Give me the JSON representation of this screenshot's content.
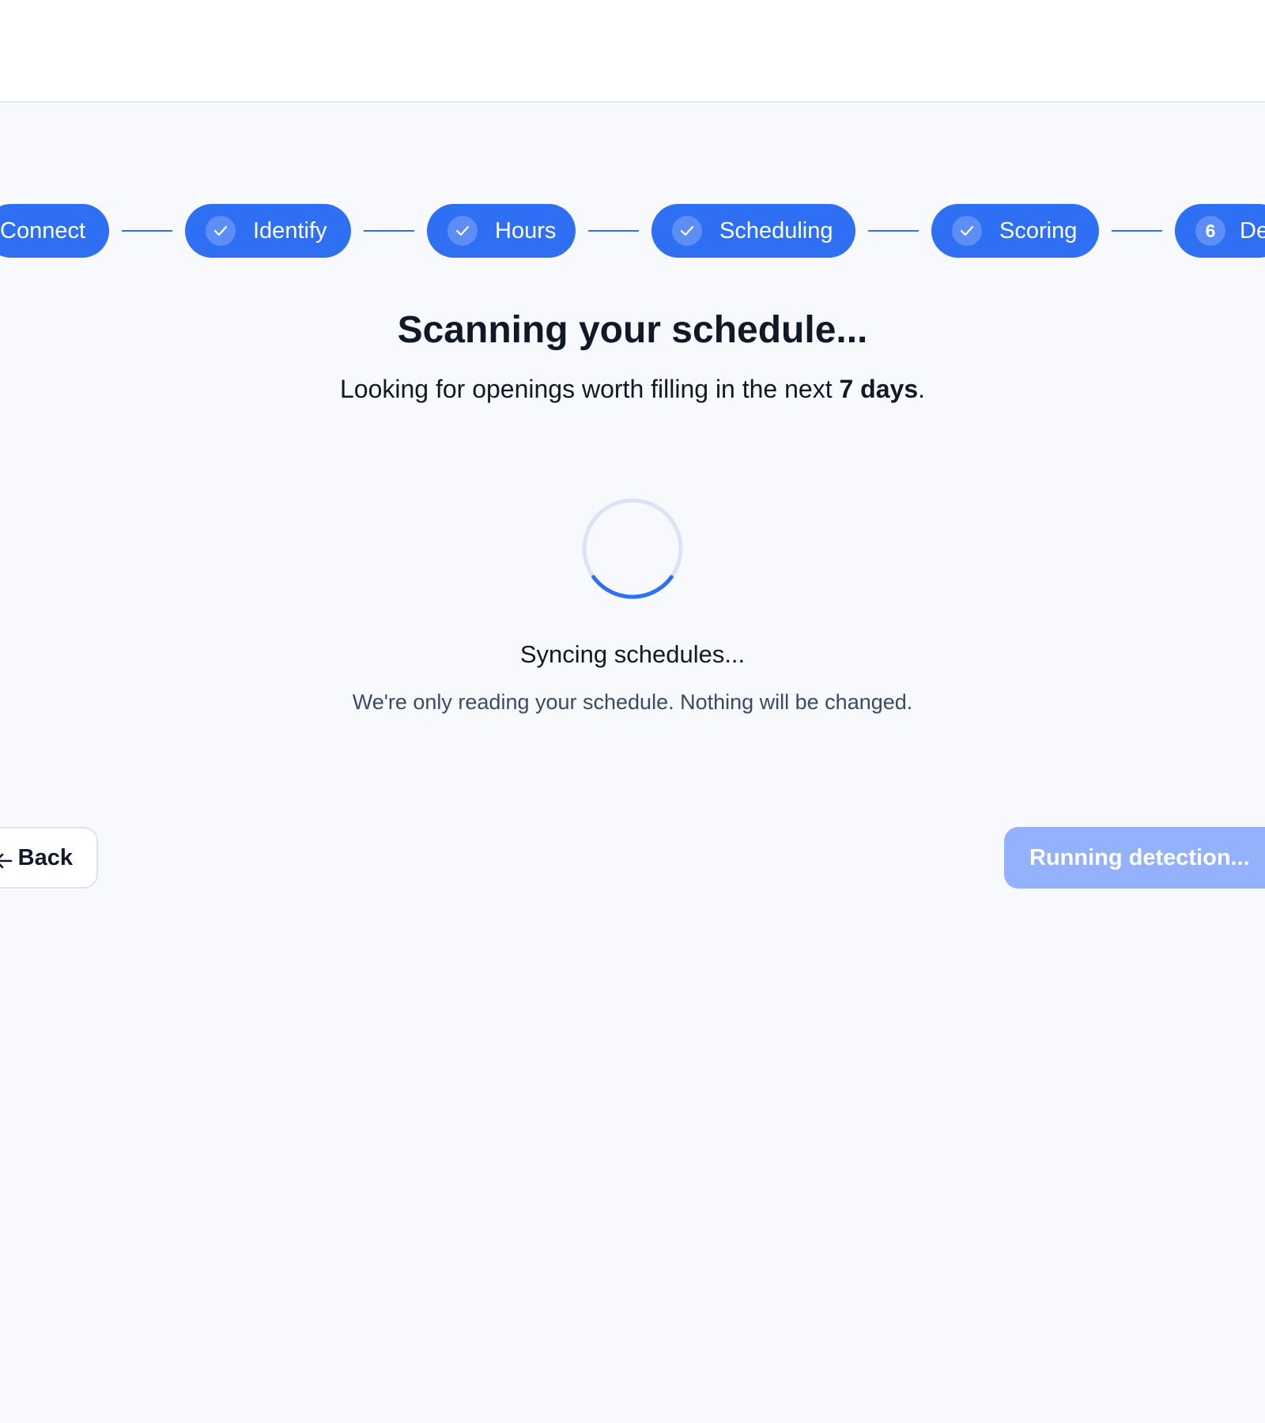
{
  "stepper": {
    "steps": [
      {
        "label": "Connect",
        "status": "complete"
      },
      {
        "label": "Identify",
        "status": "complete"
      },
      {
        "label": "Hours",
        "status": "complete"
      },
      {
        "label": "Scheduling",
        "status": "complete"
      },
      {
        "label": "Scoring",
        "status": "complete"
      },
      {
        "label": "De",
        "number": "6",
        "status": "current"
      }
    ]
  },
  "main": {
    "title": "Scanning your schedule...",
    "subtitle_prefix": "Looking for openings worth filling in the next ",
    "subtitle_emphasis": "7 days",
    "subtitle_suffix": ".",
    "spinner_progress": 0.3,
    "status": "Syncing schedules...",
    "note": "We're only reading your schedule. Nothing will be changed."
  },
  "footer": {
    "back_label": "Back",
    "primary_label": "Running detection..."
  },
  "colors": {
    "accent": "#2f6ff3",
    "disabled_accent": "#93b2fb",
    "background": "#f7f9fc"
  }
}
